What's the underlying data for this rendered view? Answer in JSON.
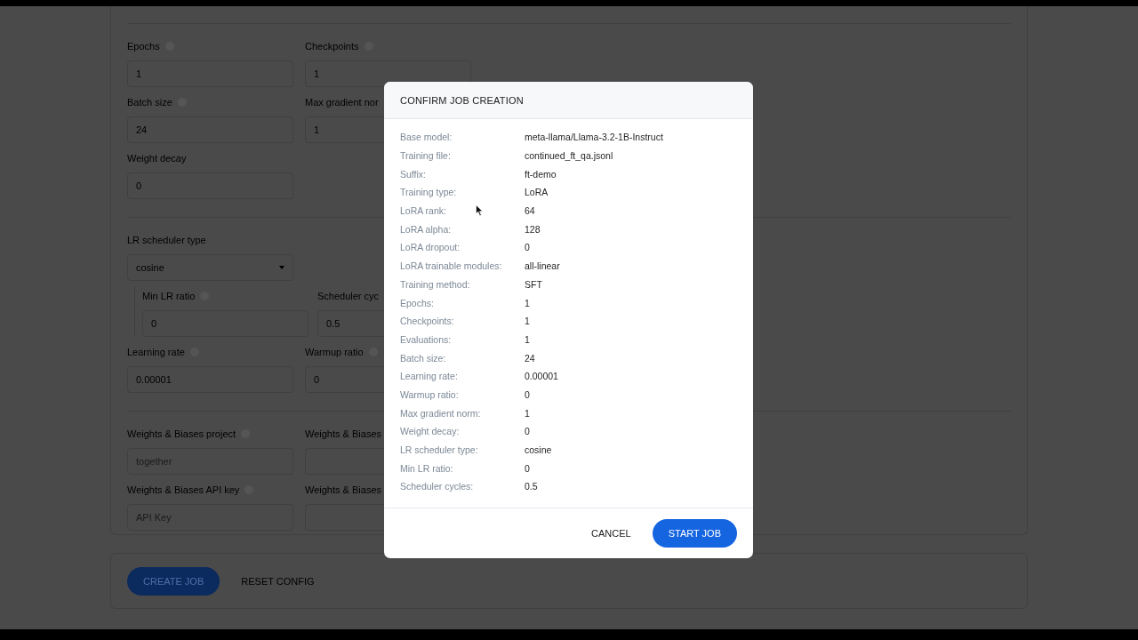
{
  "form": {
    "sections": [
      {
        "rows": [
          {
            "fields": [
              {
                "label": "Epochs",
                "info": true,
                "kind": "input",
                "value": "1"
              },
              {
                "label": "Checkpoints",
                "info": true,
                "kind": "input",
                "value": "1"
              }
            ]
          },
          {
            "fields": [
              {
                "label": "Batch size",
                "info": true,
                "kind": "input",
                "value": "24"
              },
              {
                "label": "Max gradient nor",
                "kind": "input",
                "value": "1"
              }
            ]
          },
          {
            "fields": [
              {
                "label": "Weight decay",
                "kind": "input",
                "value": "0"
              }
            ]
          }
        ]
      },
      {
        "rows": [
          {
            "fields": [
              {
                "label": "LR scheduler type",
                "kind": "select",
                "value": "cosine"
              }
            ]
          },
          {
            "indented": true,
            "fields": [
              {
                "label": "Min LR ratio",
                "info": true,
                "kind": "input",
                "value": "0"
              },
              {
                "label": "Scheduler cyc",
                "kind": "input",
                "value": "0.5"
              }
            ]
          },
          {
            "fields": [
              {
                "label": "Learning rate",
                "info": true,
                "kind": "input",
                "value": "0.00001"
              },
              {
                "label": "Warmup ratio",
                "info": true,
                "kind": "input",
                "value": "0"
              }
            ]
          }
        ]
      },
      {
        "rows": [
          {
            "fields": [
              {
                "label": "Weights & Biases project",
                "info": true,
                "kind": "input",
                "placeholder": "together"
              },
              {
                "label": "Weights & Biases",
                "kind": "input"
              }
            ]
          },
          {
            "fields": [
              {
                "label": "Weights & Biases API key",
                "info": true,
                "kind": "input",
                "placeholder": "API Key"
              },
              {
                "label": "Weights & Biases",
                "kind": "input"
              }
            ]
          }
        ]
      }
    ]
  },
  "actions": [
    {
      "label": "CREATE JOB",
      "kind": "primary"
    },
    {
      "label": "RESET CONFIG",
      "kind": "text"
    }
  ],
  "dialog": {
    "title": "CONFIRM JOB CREATION",
    "details": [
      {
        "label": "Base model:",
        "value": "meta-llama/Llama-3.2-1B-Instruct"
      },
      {
        "label": "Training file:",
        "value": "continued_ft_qa.jsonl"
      },
      {
        "label": "Suffix:",
        "value": "ft-demo"
      },
      {
        "label": "Training type:",
        "value": "LoRA"
      },
      {
        "label": "LoRA rank:",
        "value": "64"
      },
      {
        "label": "LoRA alpha:",
        "value": "128"
      },
      {
        "label": "LoRA dropout:",
        "value": "0"
      },
      {
        "label": "LoRA trainable modules:",
        "value": "all-linear"
      },
      {
        "label": "Training method:",
        "value": "SFT"
      },
      {
        "label": "Epochs:",
        "value": "1"
      },
      {
        "label": "Checkpoints:",
        "value": "1"
      },
      {
        "label": "Evaluations:",
        "value": "1"
      },
      {
        "label": "Batch size:",
        "value": "24"
      },
      {
        "label": "Learning rate:",
        "value": "0.00001"
      },
      {
        "label": "Warmup ratio:",
        "value": "0"
      },
      {
        "label": "Max gradient norm:",
        "value": "1"
      },
      {
        "label": "Weight decay:",
        "value": "0"
      },
      {
        "label": "LR scheduler type:",
        "value": "cosine"
      },
      {
        "label": "Min LR ratio:",
        "value": "0"
      },
      {
        "label": "Scheduler cycles:",
        "value": "0.5"
      }
    ],
    "buttons": [
      {
        "label": "CANCEL",
        "kind": "text"
      },
      {
        "label": "START JOB",
        "kind": "primary"
      }
    ]
  }
}
